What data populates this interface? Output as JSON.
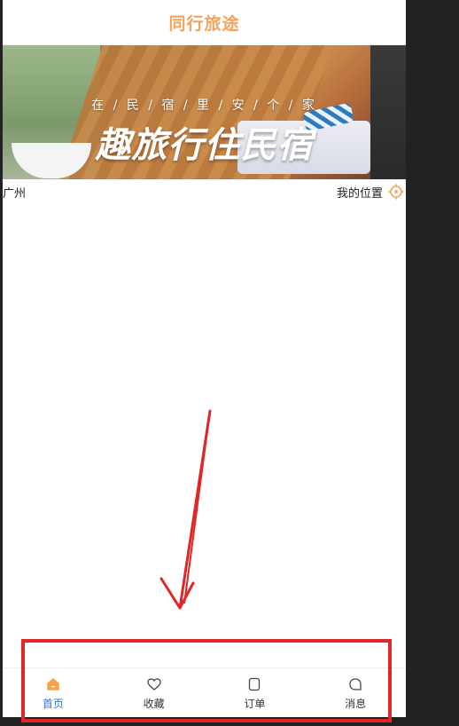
{
  "header": {
    "title": "同行旅途"
  },
  "banner": {
    "subtitle": "在 / 民 / 宿 / 里 / 安 / 个 / 家",
    "headline": "趣旅行住民宿"
  },
  "location": {
    "city": "广州",
    "my_position_label": "我的位置"
  },
  "tabbar": {
    "items": [
      {
        "label": "首页",
        "icon": "home-icon",
        "active": true
      },
      {
        "label": "收藏",
        "icon": "heart-icon",
        "active": false
      },
      {
        "label": "订单",
        "icon": "order-icon",
        "active": false
      },
      {
        "label": "消息",
        "icon": "message-icon",
        "active": false
      }
    ]
  },
  "colors": {
    "accent": "#f5a35b",
    "tab_active": "#2f76d2",
    "annotation": "#e02626"
  }
}
